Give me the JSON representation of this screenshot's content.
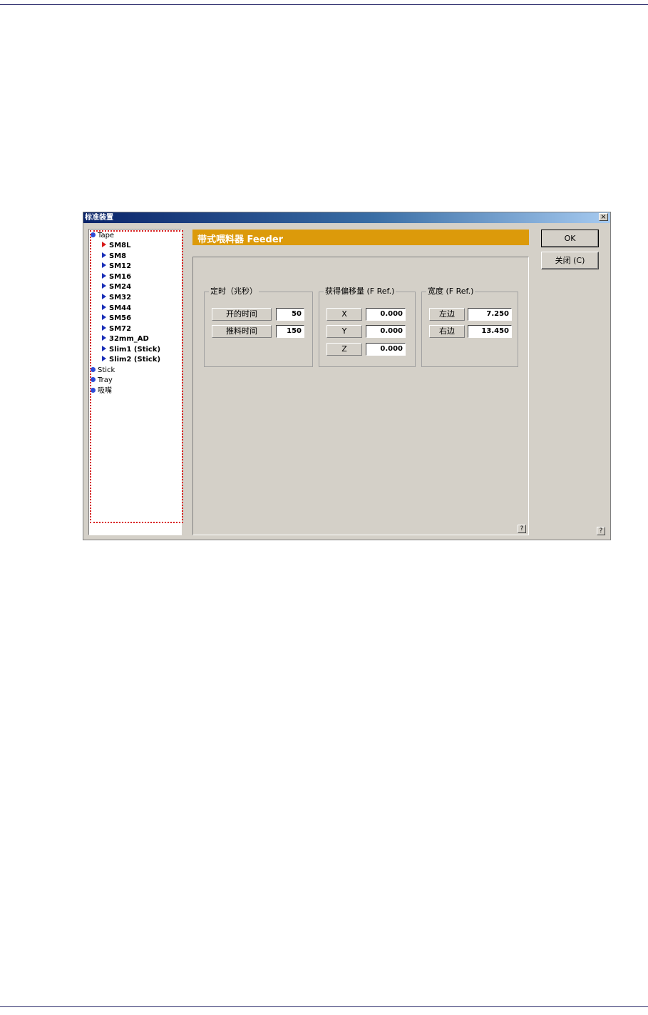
{
  "window": {
    "title": "标准装置",
    "close_label": "×"
  },
  "tree": {
    "items": [
      {
        "label": "Tape",
        "level": 0
      },
      {
        "label": "SM8L",
        "level": 1,
        "active": true
      },
      {
        "label": "SM8",
        "level": 1
      },
      {
        "label": "SM12",
        "level": 1
      },
      {
        "label": "SM16",
        "level": 1
      },
      {
        "label": "SM24",
        "level": 1
      },
      {
        "label": "SM32",
        "level": 1
      },
      {
        "label": "SM44",
        "level": 1
      },
      {
        "label": "SM56",
        "level": 1
      },
      {
        "label": "SM72",
        "level": 1
      },
      {
        "label": "32mm_AD",
        "level": 1
      },
      {
        "label": "Slim1 (Stick)",
        "level": 1
      },
      {
        "label": "Slim2 (Stick)",
        "level": 1
      },
      {
        "label": "Stick",
        "level": 0
      },
      {
        "label": "Tray",
        "level": 0
      },
      {
        "label": "吸嘴",
        "level": 0
      }
    ]
  },
  "header": {
    "title": "带式喂料器 Feeder"
  },
  "timing": {
    "legend": "定时（兆秒）",
    "open_label": "开的时间",
    "open_value": "50",
    "push_label": "推料时间",
    "push_value": "150"
  },
  "offset": {
    "legend": "获得偏移量 (F Ref.)",
    "x_label": "X",
    "x_value": "0.000",
    "y_label": "Y",
    "y_value": "0.000",
    "z_label": "Z",
    "z_value": "0.000"
  },
  "width": {
    "legend": "宽度 (F Ref.)",
    "left_label": "左边",
    "left_value": "7.250",
    "right_label": "右边",
    "right_value": "13.450"
  },
  "buttons": {
    "ok": "OK",
    "close": "关闭 (C)"
  },
  "help_label": "?"
}
